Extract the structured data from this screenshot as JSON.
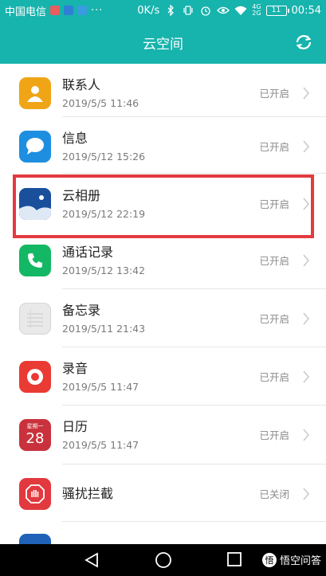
{
  "status_bar": {
    "carrier": "中国电信",
    "speed": "0K/s",
    "net_top": "4G",
    "net_bottom": "2G",
    "battery": "11",
    "time": "00:54"
  },
  "header": {
    "title": "云空间",
    "sync_icon": "sync-icon"
  },
  "colors": {
    "accent": "#17b3ad",
    "highlight": "#e33a3f"
  },
  "items": [
    {
      "name": "联系人",
      "date": "2019/5/5 11:46",
      "status": "已开启",
      "icon": "contacts-icon"
    },
    {
      "name": "信息",
      "date": "2019/5/12 15:26",
      "status": "已开启",
      "icon": "messages-icon"
    },
    {
      "name": "云相册",
      "date": "2019/5/12 22:19",
      "status": "已开启",
      "icon": "gallery-icon"
    },
    {
      "name": "通话记录",
      "date": "2019/5/12 13:42",
      "status": "已开启",
      "icon": "phone-icon"
    },
    {
      "name": "备忘录",
      "date": "2019/5/11 21:43",
      "status": "已开启",
      "icon": "notepad-icon"
    },
    {
      "name": "录音",
      "date": "2019/5/5 11:47",
      "status": "已开启",
      "icon": "recorder-icon"
    },
    {
      "name": "日历",
      "date": "2019/5/5 11:47",
      "status": "已开启",
      "icon": "calendar-icon",
      "icon_day": "28",
      "icon_label": "星期一"
    },
    {
      "name": "骚扰拦截",
      "date": "",
      "status": "已关闭",
      "icon": "block-icon"
    }
  ],
  "watermark": {
    "text": "悟空问答",
    "logo_char": "悟"
  }
}
